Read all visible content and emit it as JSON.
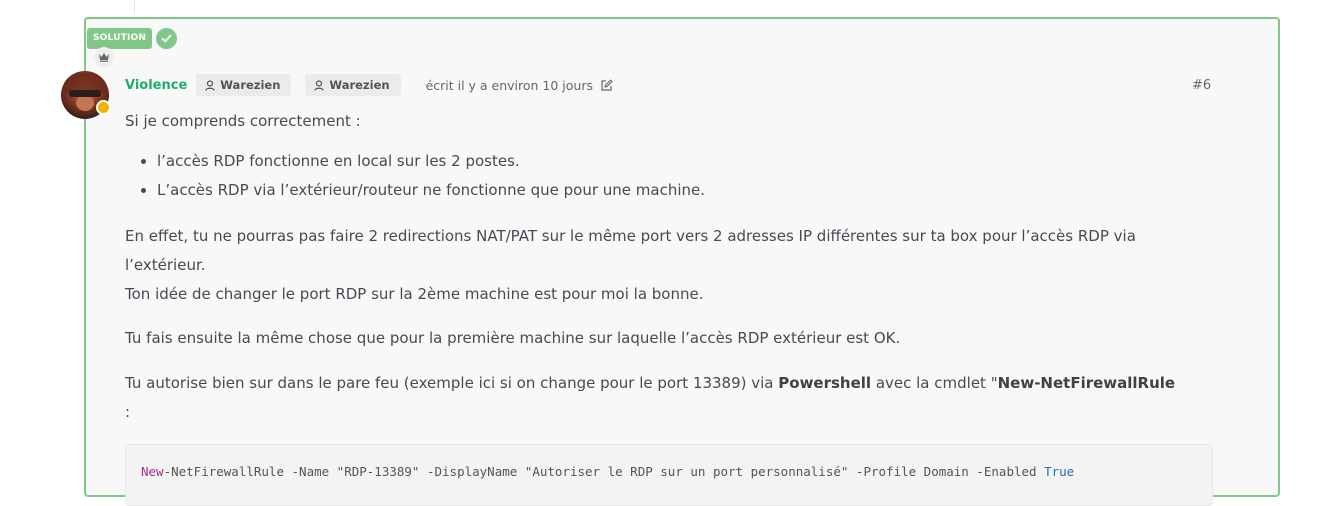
{
  "solution": {
    "label": "SOLUTION"
  },
  "post": {
    "author": "Violence",
    "groups": [
      "Warezien",
      "Warezien"
    ],
    "timeago": "écrit il y a environ 10 jours",
    "index": "#6"
  },
  "content": {
    "intro": "Si je comprends correctement :",
    "bullets": [
      "l’accès RDP fonctionne en local sur les 2 postes.",
      "L’accès RDP via l’extérieur/routeur ne fonctionne que pour une machine."
    ],
    "p_effet": "En effet, tu ne pourras pas faire 2 redirections NAT/PAT sur le même port vers 2 adresses IP différentes sur ta box pour l’accès RDP via l’extérieur.",
    "p_idee": "Ton idée de changer le port RDP sur la 2ème machine est pour moi la bonne.",
    "p_fais": "Tu fais ensuite la même chose que pour la première machine sur laquelle l’accès RDP extérieur est OK.",
    "p_auto_before": "Tu autorise bien sur dans le pare feu (exemple ici si on change pour le port 13389) via ",
    "p_auto_bold1": "Powershell",
    "p_auto_mid": " avec la cmdlet \"",
    "p_auto_bold2": "New-NetFirewallRule",
    "p_auto_after": " :"
  },
  "code": {
    "keyword": "New",
    "body": "-NetFirewallRule -Name \"RDP-13389\" -DisplayName \"Autoriser le RDP sur un port personnalisé\" -Profile Domain -Enabled ",
    "bool": "True"
  },
  "colors": {
    "accent": "#82c788",
    "author": "#1cae6e",
    "status_dot": "#f0b400"
  }
}
